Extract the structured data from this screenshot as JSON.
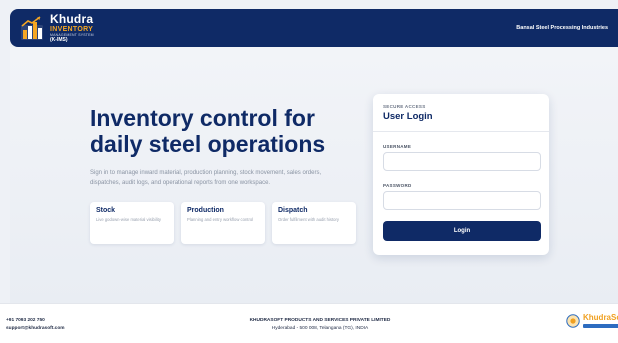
{
  "header": {
    "brand_name": "Khudra",
    "brand_product": "INVENTORY",
    "brand_tagline": "MANAGEMENT SYSTEM",
    "brand_code": "(K-IMS)",
    "company_name": "Bansal Steel Processing Industries"
  },
  "hero": {
    "title": "Inventory control for daily steel operations",
    "description": "Sign in to manage inward material, production planning, stock movement, sales orders, dispatches, audit logs, and operational reports from one workspace.",
    "features": [
      {
        "title": "Stock",
        "description": "Live godown-wise material visibility"
      },
      {
        "title": "Production",
        "description": "Planning and entry workflow control"
      },
      {
        "title": "Dispatch",
        "description": "Order fulfilment with audit history"
      }
    ]
  },
  "login": {
    "eyebrow": "SECURE ACCESS",
    "title": "User Login",
    "username_label": "USERNAME",
    "username_value": "",
    "password_label": "PASSWORD",
    "password_value": "",
    "button_label": "Login"
  },
  "footer": {
    "phone": "+91 7093 202 750",
    "email": "support@khudrasoft.com",
    "company": "KHUDRASOFT PRODUCTS AND SERVICES PRIVATE LIMITED",
    "address": "Hyderabad - 500 008, Telangana (TG), INDIA",
    "logo_text": "KhudraSof"
  },
  "colors": {
    "primary": "#0f2a66",
    "accent": "#f5a623",
    "background": "#eef1f6"
  },
  "icons": {
    "brand_logo": "steel-factory-logo-icon",
    "footer_logo": "khudrasoft-emblem-icon"
  }
}
